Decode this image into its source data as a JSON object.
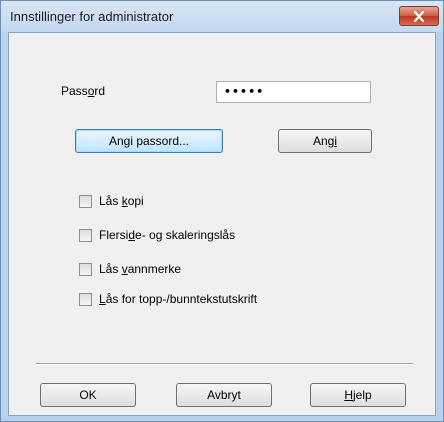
{
  "window": {
    "title": "Innstillinger for administrator"
  },
  "password": {
    "label_pre": "Pass",
    "label_u": "o",
    "label_post": "rd",
    "value": "•••••"
  },
  "buttons": {
    "set_password": "Angi passord...",
    "set_pre": "Ang",
    "set_u": "i",
    "ok": "OK",
    "cancel": "Avbryt",
    "help_u": "H",
    "help_post": "jelp"
  },
  "checkboxes": [
    {
      "pre": "Lås ",
      "u": "k",
      "post": "opi",
      "checked": false
    },
    {
      "pre": "Flersi",
      "u": "d",
      "post": "e- og skaleringslås",
      "checked": false
    },
    {
      "pre": "Lås ",
      "u": "v",
      "post": "annmerke",
      "checked": false
    },
    {
      "pre": "",
      "u": "L",
      "post": "ås for topp-/bunntekstutskrift",
      "checked": false
    }
  ],
  "colors": {
    "close_button": "#c0391f",
    "default_button_border": "#3c7fb1"
  },
  "icons": {
    "close": "close-icon"
  }
}
